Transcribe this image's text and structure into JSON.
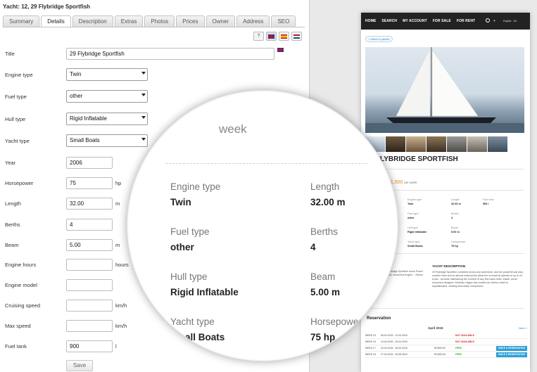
{
  "admin": {
    "title": "Yacht: 12, 29 Flybridge Sportfish",
    "tabs": [
      {
        "label": "Summary",
        "active": false
      },
      {
        "label": "Details",
        "active": true
      },
      {
        "label": "Description",
        "active": false
      },
      {
        "label": "Extras",
        "active": false
      },
      {
        "label": "Photos",
        "active": false
      },
      {
        "label": "Prices",
        "active": false
      },
      {
        "label": "Owner",
        "active": false
      },
      {
        "label": "Address",
        "active": false
      },
      {
        "label": "SEO",
        "active": false
      }
    ],
    "lang_help_label": "?",
    "languages": [
      "english-flag-icon",
      "spanish-flag-icon",
      "dutch-flag-icon"
    ],
    "fields": {
      "title": {
        "label": "Title",
        "value": "29 Flybridge Sportfish"
      },
      "engine_type": {
        "label": "Engine type",
        "value": "Twin"
      },
      "fuel_type": {
        "label": "Fuel type",
        "value": "other"
      },
      "hull_type": {
        "label": "Hull type",
        "value": "Rigid Inflatable"
      },
      "yacht_type": {
        "label": "Yacht type",
        "value": "Small Boats"
      },
      "year": {
        "label": "Year",
        "value": "2006"
      },
      "horsepower": {
        "label": "Horsepower",
        "value": "75",
        "unit": "hp"
      },
      "length": {
        "label": "Length",
        "value": "32.00",
        "unit": "m"
      },
      "berths": {
        "label": "Berths",
        "value": "4"
      },
      "beam": {
        "label": "Beam",
        "value": "5.00",
        "unit": "m"
      },
      "engine_hours": {
        "label": "Engine hours",
        "value": "",
        "unit": "hours"
      },
      "engine_model": {
        "label": "Engine model",
        "value": ""
      },
      "cruising_speed": {
        "label": "Cruising speed",
        "value": "",
        "unit": "km/h"
      },
      "max_speed": {
        "label": "Max speed",
        "value": "",
        "unit": "km/h"
      },
      "fuel_tank": {
        "label": "Fuel tank",
        "value": "900",
        "unit": "l"
      }
    },
    "save_label": "Save"
  },
  "preview": {
    "nav": [
      "HOME",
      "SEARCH",
      "MY ACCOUNT",
      "FOR SALE",
      "FOR RENT"
    ],
    "nav_user": "+",
    "nav_lang": "English · UK",
    "back_label": "« Back to yachts",
    "title": "29 FLYBRIDGE SPORTFISH",
    "price_prefix": "Price",
    "price": "€9,500 - €11,500",
    "price_suffix": "per week",
    "specs": [
      {
        "k": "Engine type",
        "v": "Twin"
      },
      {
        "k": "Length",
        "v": "32.00 m"
      },
      {
        "k": "Fuel tank",
        "v": "900 l"
      },
      {
        "k": "Fuel type",
        "v": "other"
      },
      {
        "k": "Berths",
        "v": "4"
      },
      {
        "k": "Hull type",
        "v": "Rigid Inflatable"
      },
      {
        "k": "Beam",
        "v": "5.00 m"
      },
      {
        "k": "Yacht type",
        "v": "Small Boats"
      },
      {
        "k": "Horsepower",
        "v": "75 hp"
      }
    ],
    "desc_left": "29 Flybridge Sportfish shore Power windshield, motorized Engine ·, Stereo",
    "desc_head": "YACHT DESCRIPTION",
    "desc_body": "29 Flybridge Sportfish combines luxury and adventure, and her powerful sail plan, modern lines and an almost vertical bow allow her to travel at speeds of up to 20 knots - all while maintaining the comfort of any first class hotel. Inside, world renowned designer Christian Liaigre has created an interior which is sophisticated, calming and totally unexpected.",
    "res_title": "Reservation",
    "res_month": "April 2015",
    "res_next": "Next »",
    "res_rows": [
      {
        "week": "WEEK 15",
        "dates": "06-04-2015 - 12-04-2015",
        "price": "",
        "status": "NOT AVAILABLE",
        "free": false,
        "button": ""
      },
      {
        "week": "WEEK 16",
        "dates": "13-04-2015 - 19-04-2015",
        "price": "",
        "status": "NOT AVAILABLE",
        "free": false,
        "button": ""
      },
      {
        "week": "WEEK 17",
        "dates": "20-04-2015 - 26-04-2015",
        "price": "€10000.00",
        "status": "FREE",
        "free": true,
        "button": "MAKE A RESERVATION"
      },
      {
        "week": "WEEK 18",
        "dates": "27-04-2015 - 03-05-2015",
        "price": "€10000.00",
        "status": "FREE",
        "free": true,
        "button": "MAKE A RESERVATION"
      }
    ],
    "colors": {
      "price": "#e8891b",
      "not_available": "#d9232d",
      "free": "#2fb82f",
      "button": "#2d9fd8"
    }
  },
  "magnifier": {
    "week_text": "week",
    "items": [
      {
        "k": "Engine type",
        "v": "Twin"
      },
      {
        "k": "Length",
        "v": "32.00 m"
      },
      {
        "k": "Fuel type",
        "v": "other"
      },
      {
        "k": "Berths",
        "v": "4"
      },
      {
        "k": "Hull type",
        "v": "Rigid Inflatable"
      },
      {
        "k": "Beam",
        "v": "5.00 m"
      },
      {
        "k": "Yacht type",
        "v": "Small Boats"
      },
      {
        "k": "Horsepower",
        "v": "75 hp"
      }
    ]
  }
}
